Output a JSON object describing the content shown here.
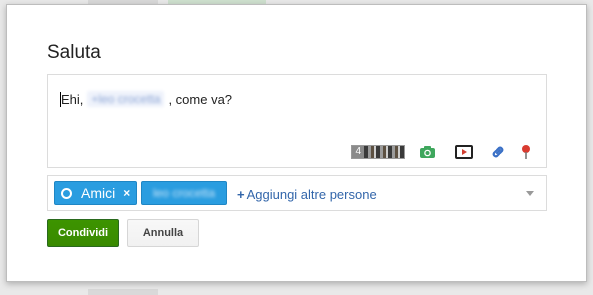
{
  "dialog": {
    "title": "Saluta"
  },
  "compose": {
    "greeting": "Ehi,",
    "mention": "+leo crocetta",
    "message_rest": ", come va?",
    "photo_count": "4",
    "icons": [
      "photo-thumbnails",
      "camera-icon",
      "video-icon",
      "link-icon",
      "location-pin-icon"
    ]
  },
  "recipients": {
    "circle_chip_label": "Amici",
    "circle_chip_remove": "×",
    "person_chip_label": "leo crocetta",
    "add_people_plus": "+",
    "add_people_label": "Aggiungi altre persone"
  },
  "actions": {
    "share_label": "Condividi",
    "cancel_label": "Annulla"
  },
  "colors": {
    "chip_blue": "#2a9de0",
    "share_green": "#3d9400",
    "link_blue": "#3366aa",
    "camera_green": "#3fa75d",
    "pin_red": "#d93b30"
  }
}
